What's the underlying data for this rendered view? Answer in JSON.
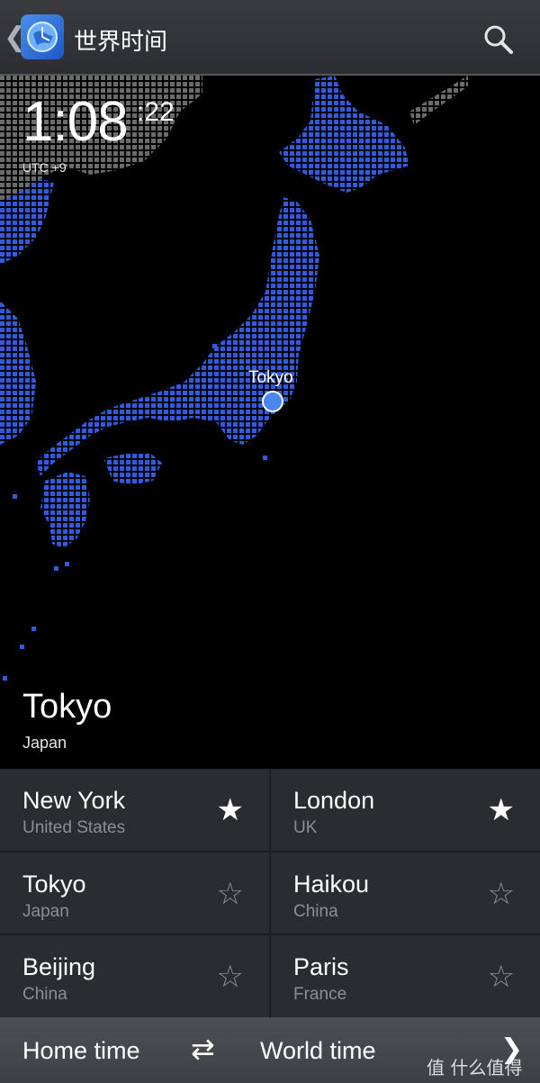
{
  "header": {
    "back_icon": "chevron-left-icon",
    "app_icon": "globe-clock-icon",
    "title": "世界时间",
    "search_icon": "search-icon"
  },
  "clock": {
    "hours_minutes": "1:08",
    "seconds": ":22",
    "utc_offset": "UTC +9"
  },
  "map": {
    "marker_label": "Tokyo",
    "colors": {
      "land": "#2f5bdc",
      "night": "#6b6b6b",
      "marker": "#4a86f0"
    }
  },
  "selected_city": {
    "name": "Tokyo",
    "country": "Japan"
  },
  "cities": [
    {
      "name": "New York",
      "country": "United States",
      "favorite": true
    },
    {
      "name": "London",
      "country": "UK",
      "favorite": true
    },
    {
      "name": "Tokyo",
      "country": "Japan",
      "favorite": false
    },
    {
      "name": "Haikou",
      "country": "China",
      "favorite": false
    },
    {
      "name": "Beijing",
      "country": "China",
      "favorite": false
    },
    {
      "name": "Paris",
      "country": "France",
      "favorite": false
    }
  ],
  "star_glyphs": {
    "on": "★",
    "off": "☆"
  },
  "bottom_bar": {
    "home_label": "Home time",
    "swap_icon": "swap-arrows-icon",
    "world_label": "World time",
    "next_icon": "chevron-right-icon"
  },
  "watermark": "值 什么值得买"
}
